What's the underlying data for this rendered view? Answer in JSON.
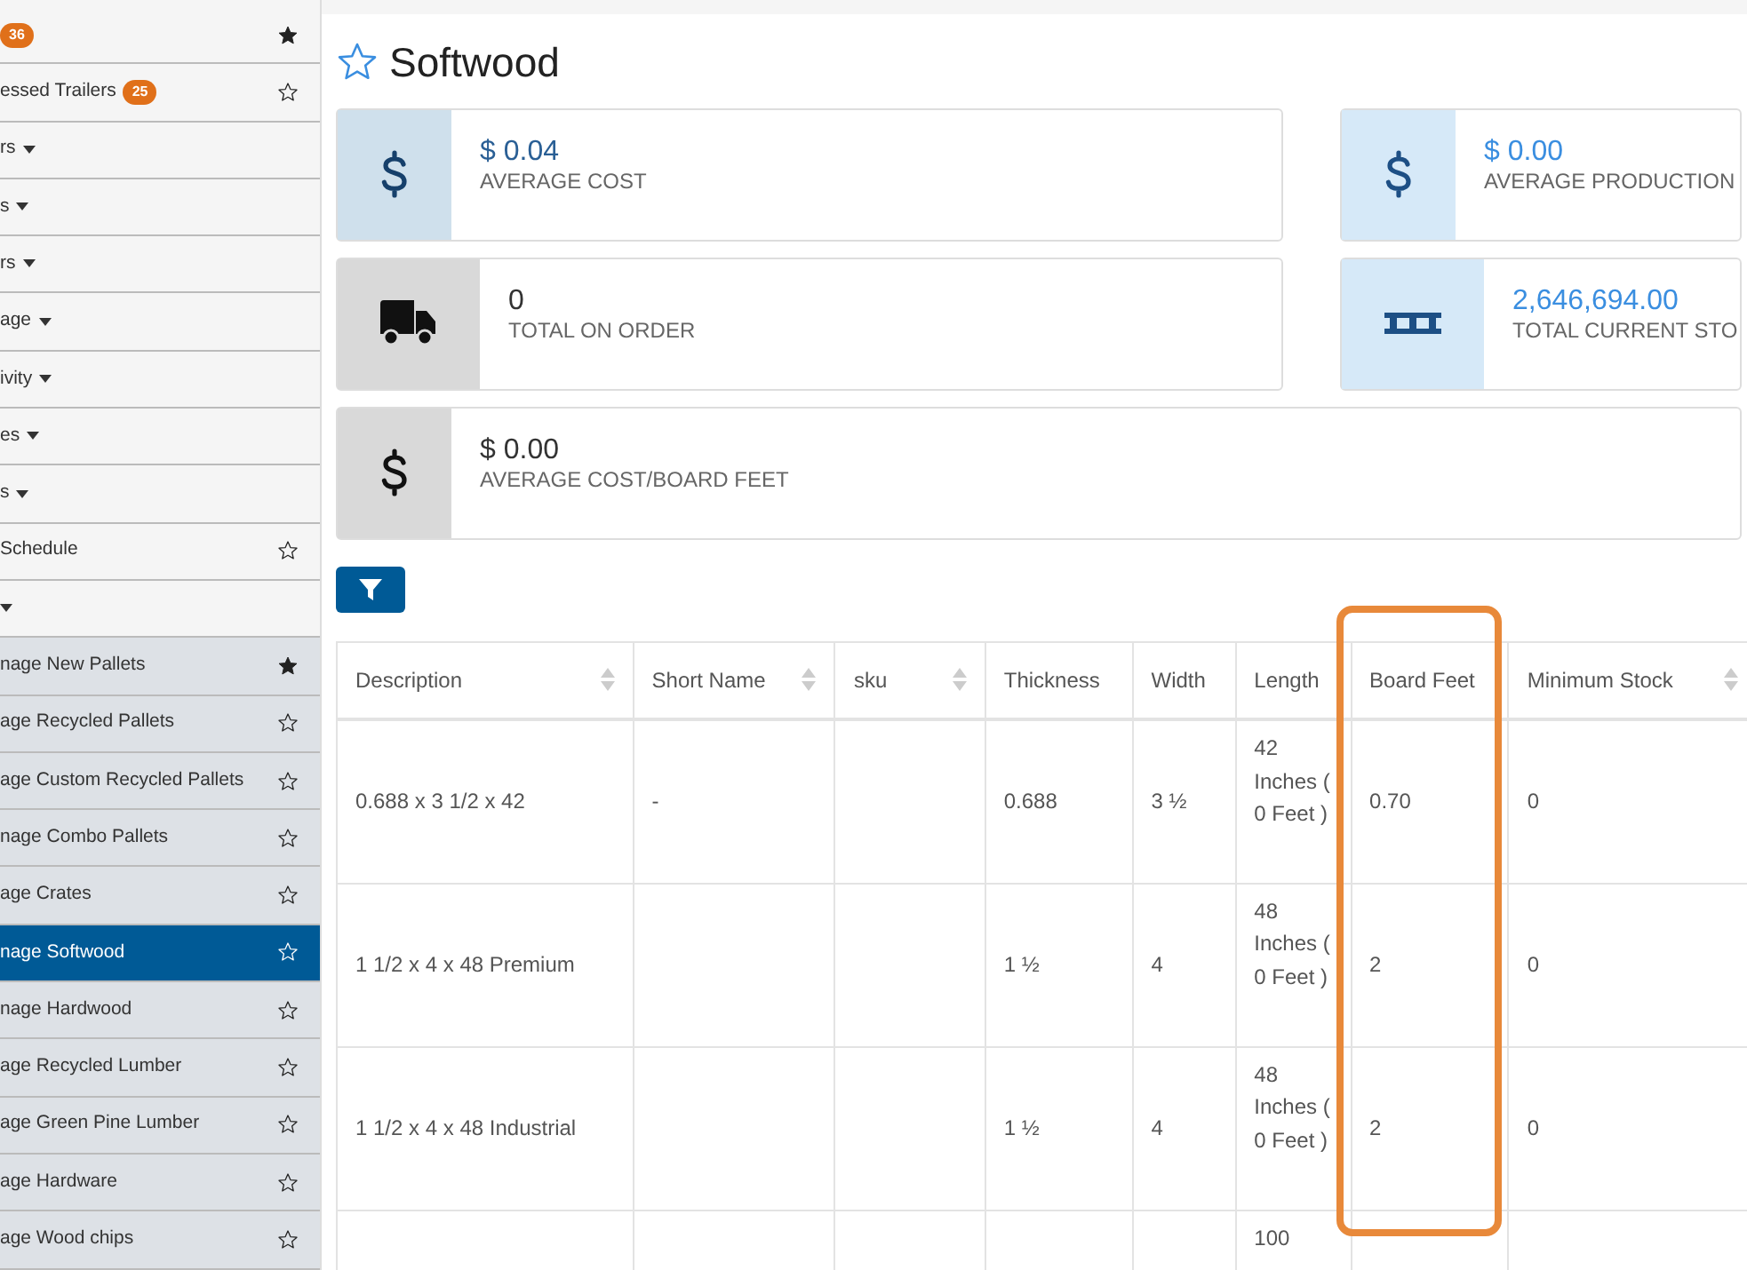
{
  "sidebar": {
    "items": [
      {
        "kind": "link",
        "badge": "36",
        "favorite": true
      },
      {
        "kind": "link",
        "label": "essed Trailers",
        "badge": "25",
        "favorite": false
      },
      {
        "kind": "dropdown",
        "label": "rs"
      },
      {
        "kind": "dropdown",
        "label": "s"
      },
      {
        "kind": "dropdown",
        "label": "rs"
      },
      {
        "kind": "dropdown",
        "label": "age"
      },
      {
        "kind": "dropdown",
        "label": "ivity"
      },
      {
        "kind": "dropdown",
        "label": "es"
      },
      {
        "kind": "dropdown",
        "label": "s"
      },
      {
        "kind": "link",
        "label": "Schedule",
        "favorite": false
      },
      {
        "kind": "dropdown",
        "children": [
          {
            "label": "nage New Pallets",
            "favorite": true,
            "selected": false
          },
          {
            "label": "age Recycled Pallets",
            "favorite": false,
            "selected": false
          },
          {
            "label": "age Custom Recycled Pallets",
            "favorite": false,
            "selected": false
          },
          {
            "label": "nage Combo Pallets",
            "favorite": false,
            "selected": false
          },
          {
            "label": "age Crates",
            "favorite": false,
            "selected": false
          },
          {
            "label": "nage Softwood",
            "favorite": false,
            "selected": true
          },
          {
            "label": "nage Hardwood",
            "favorite": false,
            "selected": false
          },
          {
            "label": "age Recycled Lumber",
            "favorite": false,
            "selected": false
          },
          {
            "label": "age Green Pine Lumber",
            "favorite": false,
            "selected": false
          },
          {
            "label": "age Hardware",
            "favorite": false,
            "selected": false
          },
          {
            "label": "age Wood chips",
            "favorite": false,
            "selected": false
          }
        ]
      }
    ]
  },
  "page": {
    "title": "Softwood",
    "favorite": false
  },
  "stats": [
    {
      "kind": "dollar",
      "color": "#cfe0ec",
      "value": "$ 0.04",
      "label": "AVERAGE COST"
    },
    {
      "kind": "dollar",
      "color": "#d6e9f8",
      "value": "$ 0.00",
      "label": "AVERAGE PRODUCTION"
    },
    {
      "kind": "truck",
      "color": "#d9d9d9",
      "value": "0",
      "label": "TOTAL ON ORDER"
    },
    {
      "kind": "pallet",
      "color": "#d6e9f8",
      "value": "2,646,694.00",
      "label": "TOTAL CURRENT STO"
    },
    {
      "kind": "dollar",
      "color": "#d9d9d9",
      "value": "$ 0.00",
      "label": "AVERAGE COST/BOARD FEET"
    }
  ],
  "table": {
    "columns": [
      {
        "label": "Description",
        "sortable": true,
        "highlighted": false
      },
      {
        "label": "Short Name",
        "sortable": true,
        "highlighted": false
      },
      {
        "label": "sku",
        "sortable": true,
        "highlighted": false
      },
      {
        "label": "Thickness",
        "sortable": false,
        "highlighted": false
      },
      {
        "label": "Width",
        "sortable": false,
        "highlighted": false
      },
      {
        "label": "Length",
        "sortable": false,
        "highlighted": false
      },
      {
        "label": "Board Feet",
        "sortable": false,
        "highlighted": true
      },
      {
        "label": "Minimum Stock",
        "sortable": true,
        "highlighted": false
      }
    ],
    "rows": [
      [
        "0.688 x 3 1/2 x 42",
        "-",
        "",
        "0.688",
        "3 ½",
        "42 Inches ( 0 Feet )",
        "0.70",
        "0"
      ],
      [
        "1 1/2 x 4 x 48 Premium",
        "",
        "",
        "1 ½",
        "4",
        "48 Inches ( 0 Feet )",
        "2",
        "0"
      ],
      [
        "1 1/2 x 4 x 48 Industrial",
        "",
        "",
        "1 ½",
        "4",
        "48 Inches ( 0 Feet )",
        "2",
        "0"
      ],
      [
        "",
        "",
        "",
        "",
        "",
        "100",
        "",
        ""
      ]
    ]
  }
}
